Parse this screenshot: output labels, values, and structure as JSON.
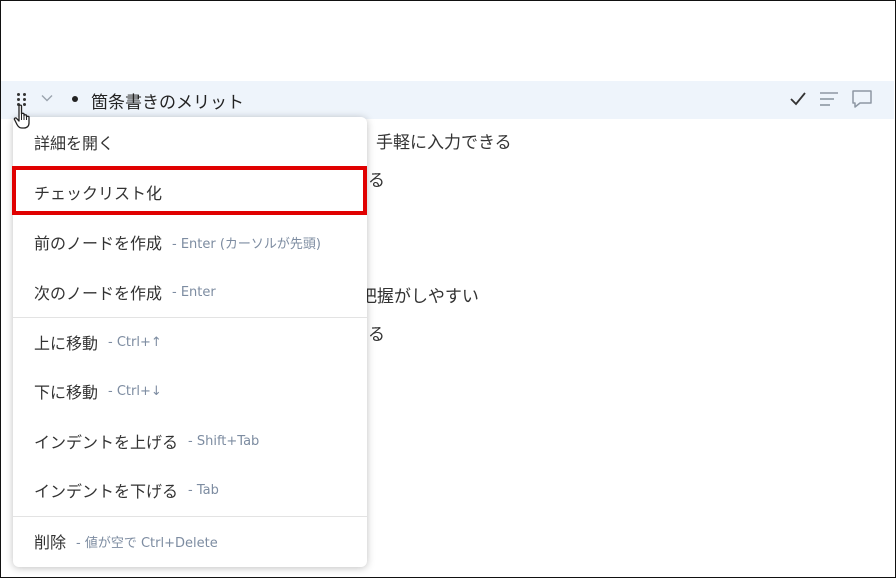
{
  "node": {
    "title": "箇条書きのメリット"
  },
  "background_lines": [
    "手軽に入力できる",
    "る",
    "把握がしやすい",
    "る"
  ],
  "menu": {
    "items": [
      {
        "label": "詳細を開く",
        "shortcut": ""
      },
      {
        "label": "チェックリスト化",
        "shortcut": ""
      },
      {
        "label": "前のノードを作成",
        "shortcut": "- Enter (カーソルが先頭)"
      },
      {
        "label": "次のノードを作成",
        "shortcut": "- Enter"
      },
      {
        "label": "上に移動",
        "shortcut": "- Ctrl+↑"
      },
      {
        "label": "下に移動",
        "shortcut": "- Ctrl+↓"
      },
      {
        "label": "インデントを上げる",
        "shortcut": "- Shift+Tab"
      },
      {
        "label": "インデントを下げる",
        "shortcut": "- Tab"
      },
      {
        "label": "削除",
        "shortcut": "- 値が空で Ctrl+Delete"
      }
    ]
  },
  "colors": {
    "row_highlight": "#eef4fb",
    "annotation_box": "#e00000",
    "shortcut_text": "#7d8ca1"
  },
  "icons": [
    "drag-handle-icon",
    "chevron-down-icon",
    "checkmark-icon",
    "note-lines-icon",
    "comment-icon",
    "hand-pointer-icon"
  ]
}
